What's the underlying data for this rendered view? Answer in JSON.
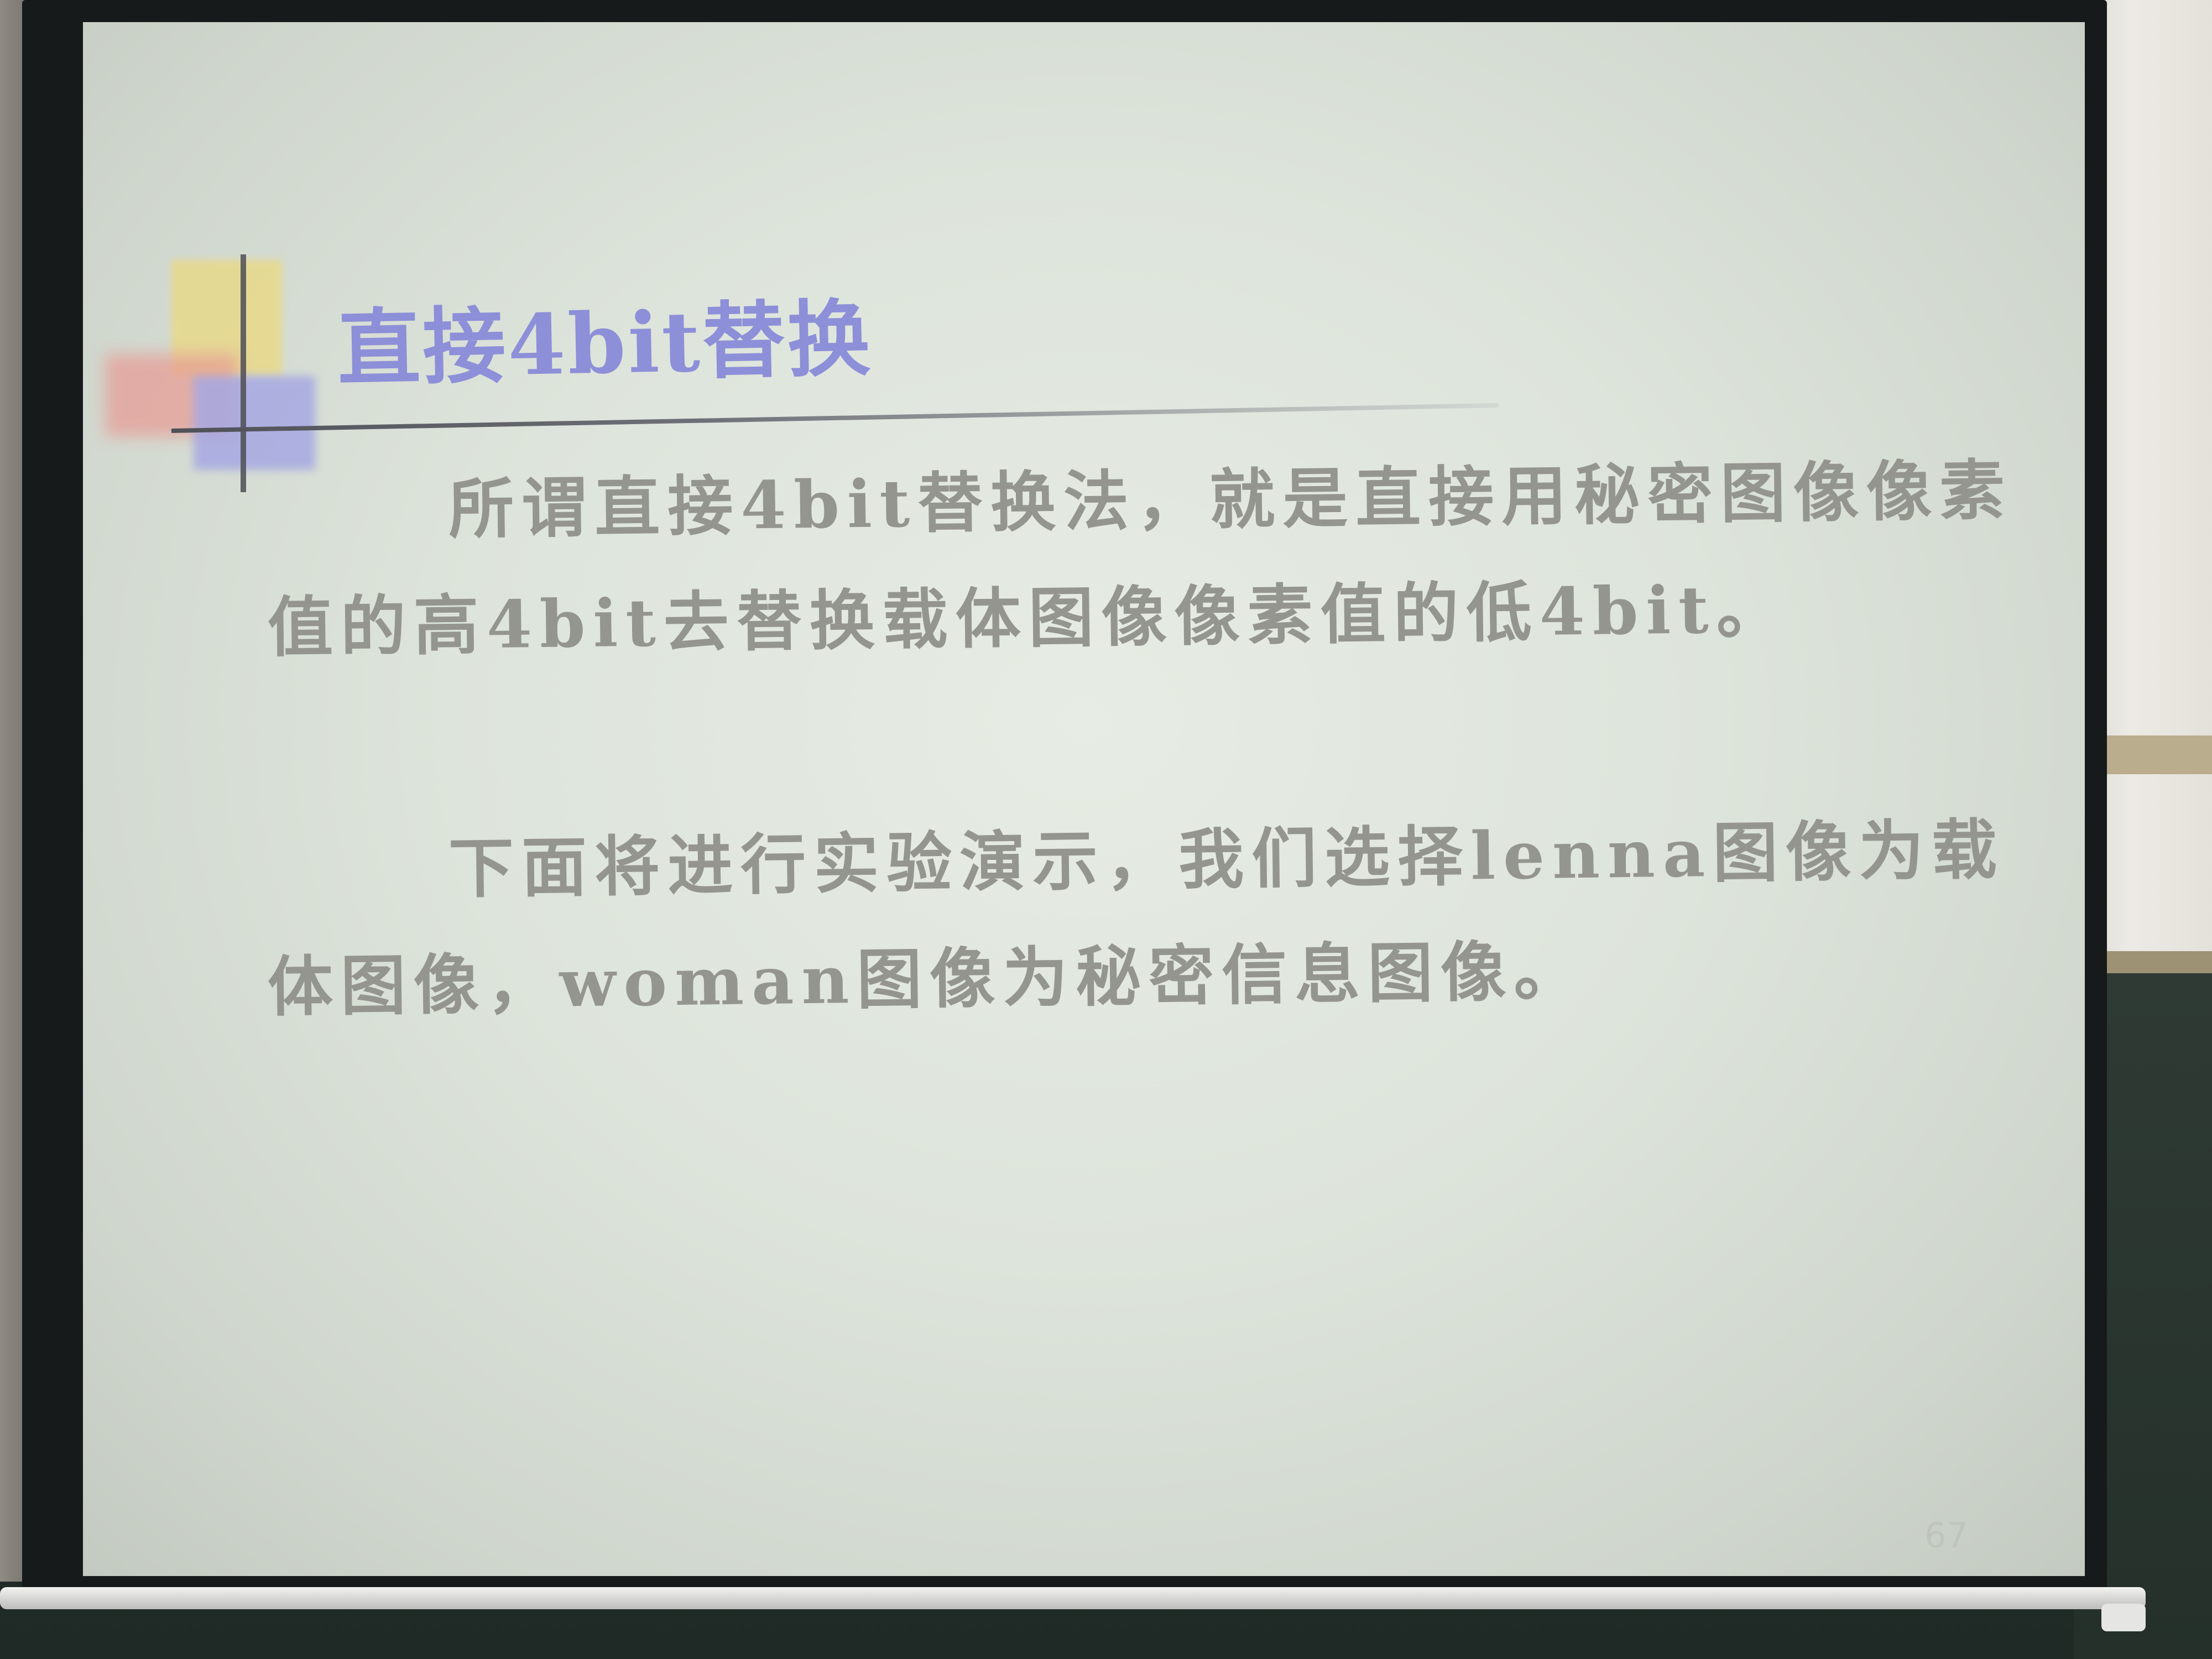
{
  "slide": {
    "title": "直接4bit替换",
    "paragraph1": "所谓直接4bit替换法，就是直接用秘密图像像素值的高4bit去替换载体图像像素值的低4bit。",
    "paragraph2": "下面将进行实验演示，我们选择lenna图像为载体图像，woman图像为秘密信息图像。",
    "page_number": "67"
  },
  "colors": {
    "title": "#8d8fd8",
    "body_text": "#95958f",
    "deco_yellow": "#e8d98a",
    "deco_red": "#e89a93",
    "deco_blue": "#a6a8e2",
    "screen": "#e2e8df",
    "frame": "#161a1b"
  }
}
